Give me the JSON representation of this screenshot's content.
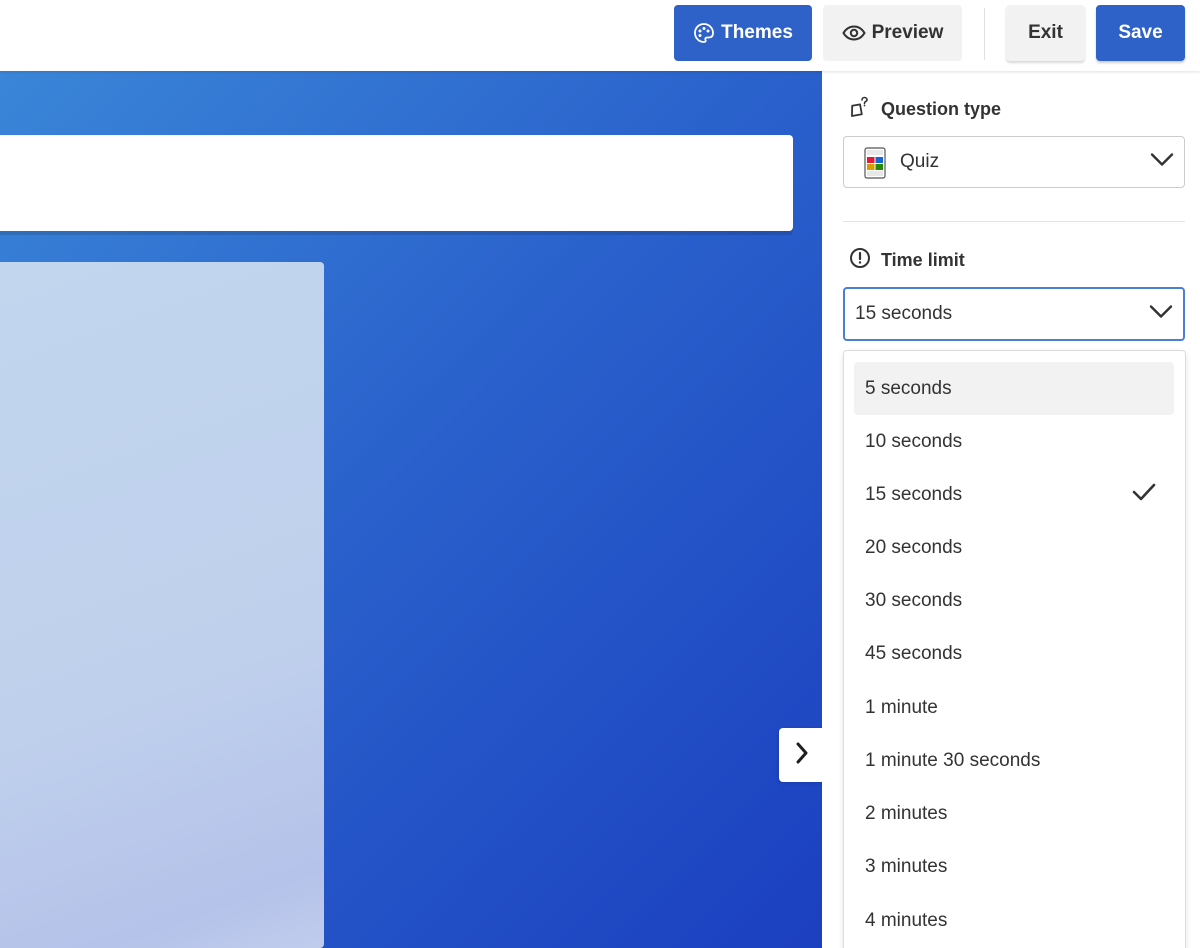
{
  "header": {
    "themes_label": "Themes",
    "preview_label": "Preview",
    "exit_label": "Exit",
    "save_label": "Save"
  },
  "sidebar": {
    "question_type": {
      "label": "Question type",
      "selected": "Quiz"
    },
    "time_limit": {
      "label": "Time limit",
      "selected": "15 seconds",
      "options": [
        {
          "label": "5 seconds",
          "highlighted": true,
          "selected": false
        },
        {
          "label": "10 seconds",
          "highlighted": false,
          "selected": false
        },
        {
          "label": "15 seconds",
          "highlighted": false,
          "selected": true
        },
        {
          "label": "20 seconds",
          "highlighted": false,
          "selected": false
        },
        {
          "label": "30 seconds",
          "highlighted": false,
          "selected": false
        },
        {
          "label": "45 seconds",
          "highlighted": false,
          "selected": false
        },
        {
          "label": "1 minute",
          "highlighted": false,
          "selected": false
        },
        {
          "label": "1 minute 30 seconds",
          "highlighted": false,
          "selected": false
        },
        {
          "label": "2 minutes",
          "highlighted": false,
          "selected": false
        },
        {
          "label": "3 minutes",
          "highlighted": false,
          "selected": false
        },
        {
          "label": "4 minutes",
          "highlighted": false,
          "selected": false
        }
      ]
    }
  },
  "icons": {
    "themes": "palette-icon",
    "preview": "eye-icon",
    "question_type": "shapes-icon",
    "quiz": "quiz-grid-icon",
    "time_limit": "clock-icon",
    "dropdown": "chevron-down-icon",
    "selected_option": "checkmark-icon",
    "next": "chevron-right-icon"
  },
  "colors": {
    "primary": "#2f62c9",
    "canvas_gradient_start": "#3a86d8",
    "canvas_gradient_end": "#1b3fc0",
    "focus_border": "#4a7fd4"
  }
}
